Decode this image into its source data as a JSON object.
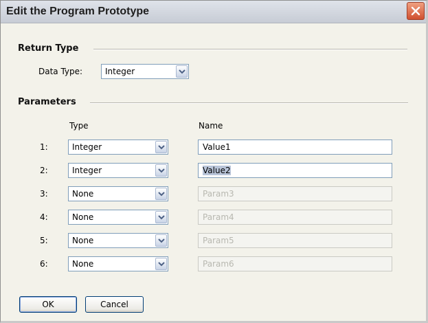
{
  "dialog": {
    "title": "Edit the Program Prototype"
  },
  "return_type": {
    "section_label": "Return Type",
    "data_type_label": "Data Type:",
    "data_type_value": "Integer"
  },
  "parameters": {
    "section_label": "Parameters",
    "type_header": "Type",
    "name_header": "Name",
    "rows": [
      {
        "index": "1:",
        "type": "Integer",
        "name": "Value1",
        "enabled": true
      },
      {
        "index": "2:",
        "type": "Integer",
        "name": "Value2",
        "enabled": true
      },
      {
        "index": "3:",
        "type": "None",
        "name": "Param3",
        "enabled": false
      },
      {
        "index": "4:",
        "type": "None",
        "name": "Param4",
        "enabled": false
      },
      {
        "index": "5:",
        "type": "None",
        "name": "Param5",
        "enabled": false
      },
      {
        "index": "6:",
        "type": "None",
        "name": "Param6",
        "enabled": false
      }
    ]
  },
  "buttons": {
    "ok": "OK",
    "cancel": "Cancel"
  },
  "icons": {
    "close": "close-icon",
    "dropdown": "chevron-down-icon"
  }
}
